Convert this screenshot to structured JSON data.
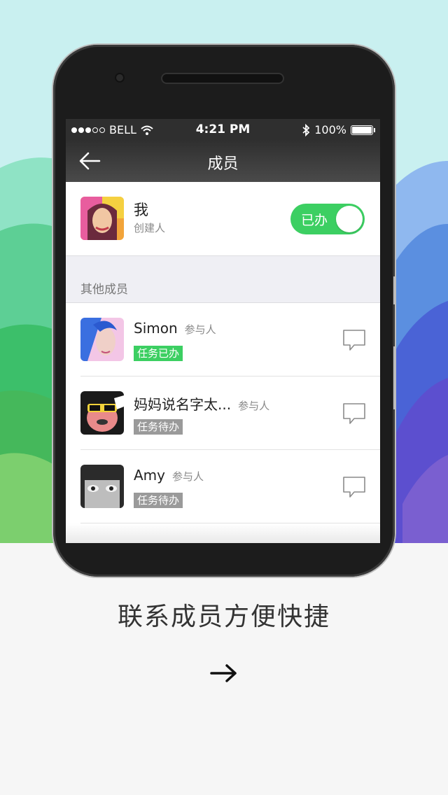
{
  "status_bar": {
    "carrier": "BELL",
    "time": "4:21 PM",
    "battery": "100%"
  },
  "nav": {
    "title": "成员",
    "back_icon": "arrow-left-icon"
  },
  "me": {
    "name": "我",
    "role": "创建人",
    "toggle_label": "已办",
    "toggle_on": true
  },
  "section_title": "其他成员",
  "members": [
    {
      "name": "Simon",
      "role": "参与人",
      "status": "任务已办",
      "status_type": "done"
    },
    {
      "name": "妈妈说名字太...",
      "role": "参与人",
      "status": "任务待办",
      "status_type": "todo"
    },
    {
      "name": "Amy",
      "role": "参与人",
      "status": "任务待办",
      "status_type": "todo"
    }
  ],
  "caption": "联系成员方便快捷",
  "next_icon": "arrow-right-icon",
  "colors": {
    "accent_green": "#3ccf62",
    "todo_gray": "#9a9a9a",
    "navbar": "#2f2f2f"
  }
}
